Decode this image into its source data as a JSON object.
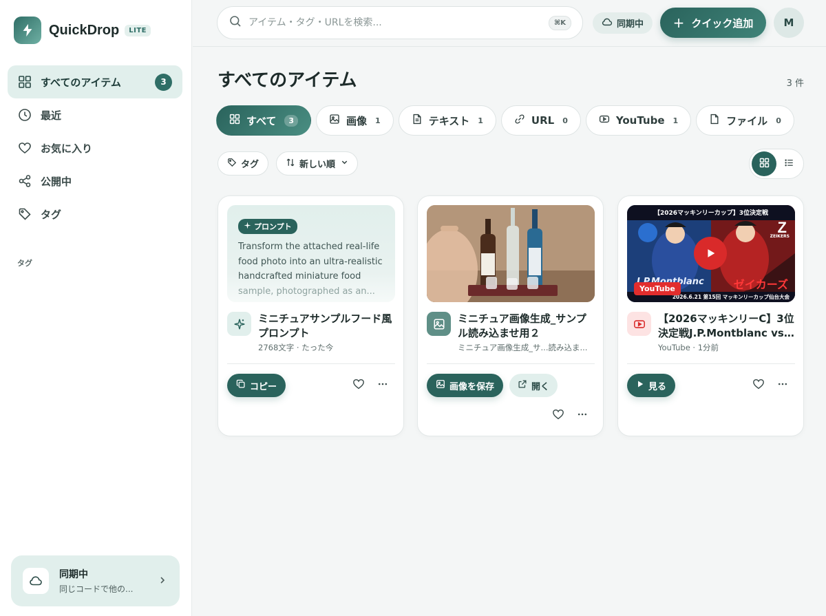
{
  "brand": {
    "name": "QuickDrop",
    "badge": "LITE"
  },
  "sidebar": {
    "items": [
      {
        "label": "すべてのアイテム",
        "count": "3"
      },
      {
        "label": "最近"
      },
      {
        "label": "お気に入り"
      },
      {
        "label": "公開中"
      },
      {
        "label": "タグ"
      }
    ],
    "tag_heading": "タグ",
    "sync": {
      "title": "同期中",
      "subtitle": "同じコードで他の..."
    }
  },
  "topbar": {
    "search_placeholder": "アイテム・タグ・URLを検索...",
    "shortcut": "⌘K",
    "sync_status": "同期中",
    "quick_add": "クイック追加",
    "avatar": "M"
  },
  "main": {
    "title": "すべてのアイテム",
    "count": "3 件",
    "tabs": [
      {
        "label": "すべて",
        "count": "3"
      },
      {
        "label": "画像",
        "count": "1"
      },
      {
        "label": "テキスト",
        "count": "1"
      },
      {
        "label": "URL",
        "count": "0"
      },
      {
        "label": "YouTube",
        "count": "1"
      },
      {
        "label": "ファイル",
        "count": "0"
      }
    ],
    "filters": {
      "tag": "タグ",
      "sort": "新しい順"
    }
  },
  "cards": [
    {
      "chip": "プロンプト",
      "preview_lines": [
        "Transform the attached real-life",
        "food photo into an ultra-realistic",
        "handcrafted miniature food",
        "sample, photographed as an..."
      ],
      "title": "ミニチュアサンプルフード風プロンプト",
      "meta": "2768文字 · たった今",
      "primary_action": "コピー"
    },
    {
      "title": "ミニチュア画像生成_サンプル読み込ませ用２",
      "meta": "ミニチュア画像生成_サ...読み込ま...",
      "primary_action": "画像を保存",
      "secondary_action": "開く"
    },
    {
      "badge": "YouTube",
      "title": "【2026マッキンリーC】3位決定戦J.P.Montblanc vs ...",
      "meta": "YouTube · 1分前",
      "primary_action": "見る",
      "thumb_header": "【2026マッキンリーカップ】3位決定戦",
      "thumb_footer": "2026.6.21 第15回 マッキンリーカップ仙台大会",
      "thumb_text_left": "J.P.Montblanc",
      "thumb_text_right": "ゼイカーズ",
      "thumb_logo": "ZEIKERS"
    }
  ],
  "colors": {
    "accent": "#2a635c",
    "accent_soft": "#e1efec",
    "youtube": "#e22d2d"
  }
}
